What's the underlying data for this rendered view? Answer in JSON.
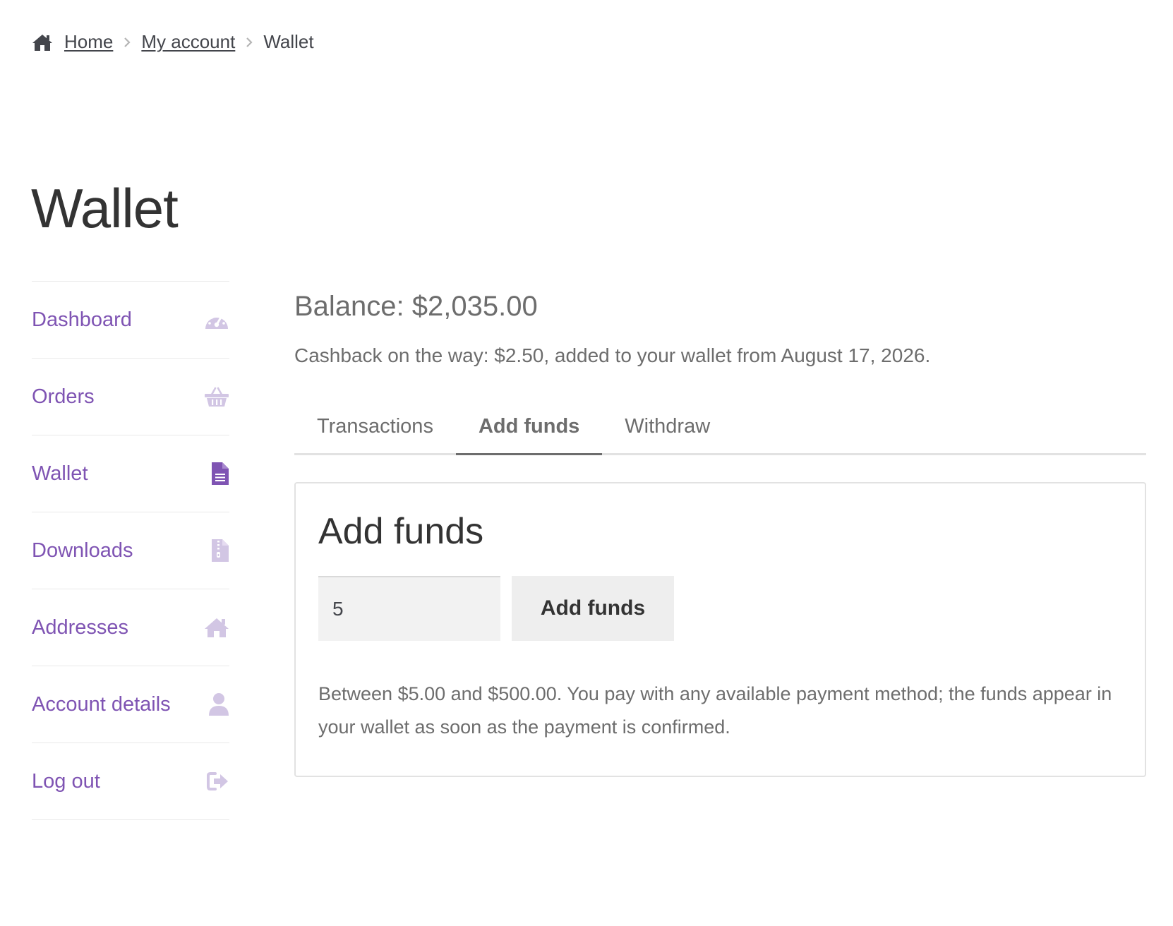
{
  "breadcrumb": {
    "home_label": "Home",
    "account_label": "My account",
    "current_label": "Wallet"
  },
  "page": {
    "title": "Wallet"
  },
  "sidebar": {
    "items": [
      {
        "label": "Dashboard",
        "icon": "dashboard-gauge-icon",
        "active": false
      },
      {
        "label": "Orders",
        "icon": "basket-icon",
        "active": false
      },
      {
        "label": "Wallet",
        "icon": "file-icon",
        "active": true
      },
      {
        "label": "Downloads",
        "icon": "file-archive-icon",
        "active": false
      },
      {
        "label": "Addresses",
        "icon": "home-icon",
        "active": false
      },
      {
        "label": "Account details",
        "icon": "user-icon",
        "active": false
      },
      {
        "label": "Log out",
        "icon": "sign-out-icon",
        "active": false
      }
    ]
  },
  "wallet": {
    "balance": "Balance: $2,035.00",
    "cashback": "Cashback on the way: $2.50, added to your wallet from August 17, 2026."
  },
  "tabs": [
    {
      "label": "Transactions",
      "active": false
    },
    {
      "label": "Add funds",
      "active": true
    },
    {
      "label": "Withdraw",
      "active": false
    }
  ],
  "add_funds": {
    "title": "Add funds",
    "amount_value": "5",
    "button_label": "Add funds",
    "help_text": "Between $5.00 and $500.00. You pay with any available payment method; the funds appear in your wallet as soon as the payment is confirmed."
  },
  "colors": {
    "link_purple": "#7f54b3",
    "icon_inactive": "#d2c6e4",
    "icon_active": "#7f54b3",
    "text": "#43454b",
    "muted": "#6d6d6d"
  }
}
